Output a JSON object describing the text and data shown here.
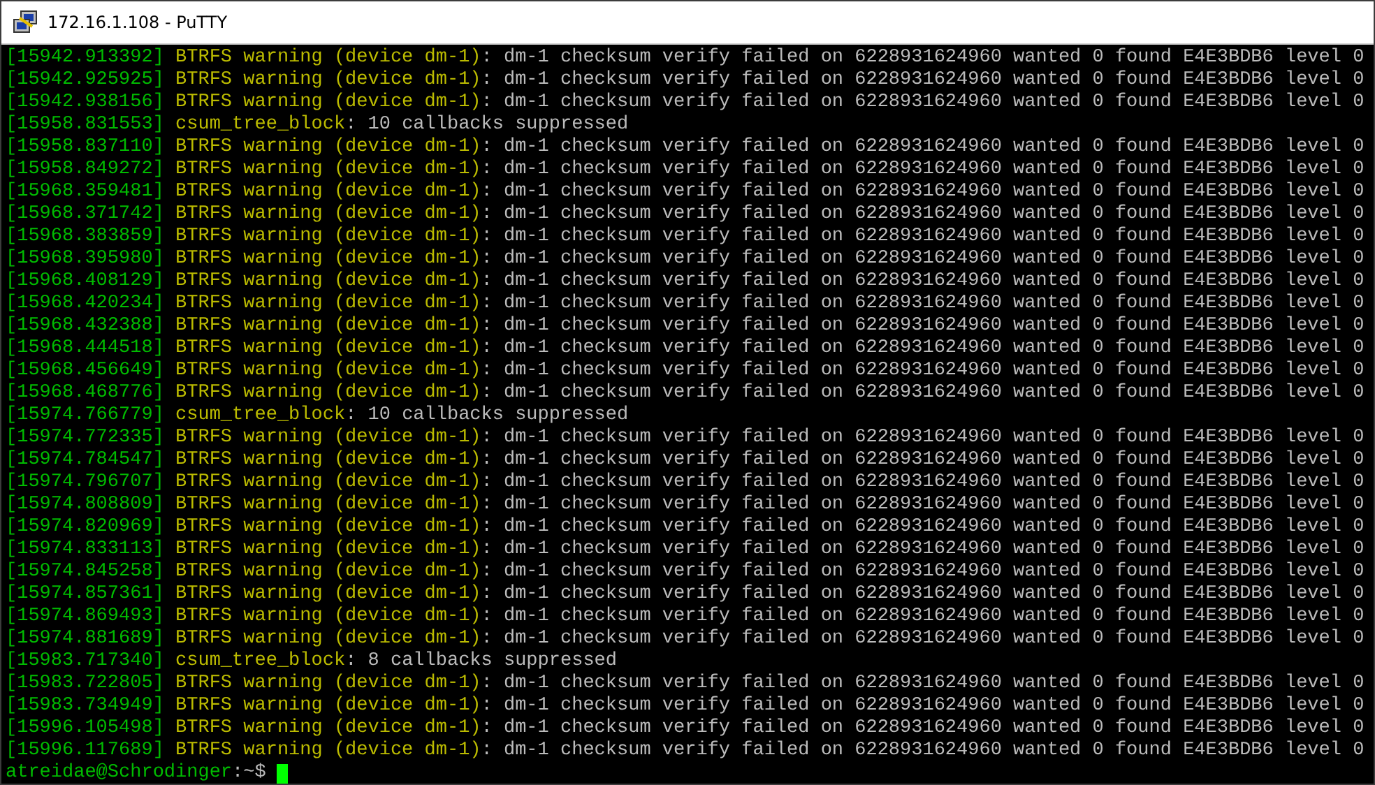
{
  "window": {
    "title": "172.16.1.108 - PuTTY"
  },
  "terminal": {
    "lines": [
      {
        "timestamp": "[15942.913392]",
        "source": "BTRFS warning (device dm-1)",
        "message": ": dm-1 checksum verify failed on 6228931624960 wanted 0 found E4E3BDB6 level 0"
      },
      {
        "timestamp": "[15942.925925]",
        "source": "BTRFS warning (device dm-1)",
        "message": ": dm-1 checksum verify failed on 6228931624960 wanted 0 found E4E3BDB6 level 0"
      },
      {
        "timestamp": "[15942.938156]",
        "source": "BTRFS warning (device dm-1)",
        "message": ": dm-1 checksum verify failed on 6228931624960 wanted 0 found E4E3BDB6 level 0"
      },
      {
        "timestamp": "[15958.831553]",
        "source": "csum_tree_block",
        "message": ": 10 callbacks suppressed"
      },
      {
        "timestamp": "[15958.837110]",
        "source": "BTRFS warning (device dm-1)",
        "message": ": dm-1 checksum verify failed on 6228931624960 wanted 0 found E4E3BDB6 level 0"
      },
      {
        "timestamp": "[15958.849272]",
        "source": "BTRFS warning (device dm-1)",
        "message": ": dm-1 checksum verify failed on 6228931624960 wanted 0 found E4E3BDB6 level 0"
      },
      {
        "timestamp": "[15968.359481]",
        "source": "BTRFS warning (device dm-1)",
        "message": ": dm-1 checksum verify failed on 6228931624960 wanted 0 found E4E3BDB6 level 0"
      },
      {
        "timestamp": "[15968.371742]",
        "source": "BTRFS warning (device dm-1)",
        "message": ": dm-1 checksum verify failed on 6228931624960 wanted 0 found E4E3BDB6 level 0"
      },
      {
        "timestamp": "[15968.383859]",
        "source": "BTRFS warning (device dm-1)",
        "message": ": dm-1 checksum verify failed on 6228931624960 wanted 0 found E4E3BDB6 level 0"
      },
      {
        "timestamp": "[15968.395980]",
        "source": "BTRFS warning (device dm-1)",
        "message": ": dm-1 checksum verify failed on 6228931624960 wanted 0 found E4E3BDB6 level 0"
      },
      {
        "timestamp": "[15968.408129]",
        "source": "BTRFS warning (device dm-1)",
        "message": ": dm-1 checksum verify failed on 6228931624960 wanted 0 found E4E3BDB6 level 0"
      },
      {
        "timestamp": "[15968.420234]",
        "source": "BTRFS warning (device dm-1)",
        "message": ": dm-1 checksum verify failed on 6228931624960 wanted 0 found E4E3BDB6 level 0"
      },
      {
        "timestamp": "[15968.432388]",
        "source": "BTRFS warning (device dm-1)",
        "message": ": dm-1 checksum verify failed on 6228931624960 wanted 0 found E4E3BDB6 level 0"
      },
      {
        "timestamp": "[15968.444518]",
        "source": "BTRFS warning (device dm-1)",
        "message": ": dm-1 checksum verify failed on 6228931624960 wanted 0 found E4E3BDB6 level 0"
      },
      {
        "timestamp": "[15968.456649]",
        "source": "BTRFS warning (device dm-1)",
        "message": ": dm-1 checksum verify failed on 6228931624960 wanted 0 found E4E3BDB6 level 0"
      },
      {
        "timestamp": "[15968.468776]",
        "source": "BTRFS warning (device dm-1)",
        "message": ": dm-1 checksum verify failed on 6228931624960 wanted 0 found E4E3BDB6 level 0"
      },
      {
        "timestamp": "[15974.766779]",
        "source": "csum_tree_block",
        "message": ": 10 callbacks suppressed"
      },
      {
        "timestamp": "[15974.772335]",
        "source": "BTRFS warning (device dm-1)",
        "message": ": dm-1 checksum verify failed on 6228931624960 wanted 0 found E4E3BDB6 level 0"
      },
      {
        "timestamp": "[15974.784547]",
        "source": "BTRFS warning (device dm-1)",
        "message": ": dm-1 checksum verify failed on 6228931624960 wanted 0 found E4E3BDB6 level 0"
      },
      {
        "timestamp": "[15974.796707]",
        "source": "BTRFS warning (device dm-1)",
        "message": ": dm-1 checksum verify failed on 6228931624960 wanted 0 found E4E3BDB6 level 0"
      },
      {
        "timestamp": "[15974.808809]",
        "source": "BTRFS warning (device dm-1)",
        "message": ": dm-1 checksum verify failed on 6228931624960 wanted 0 found E4E3BDB6 level 0"
      },
      {
        "timestamp": "[15974.820969]",
        "source": "BTRFS warning (device dm-1)",
        "message": ": dm-1 checksum verify failed on 6228931624960 wanted 0 found E4E3BDB6 level 0"
      },
      {
        "timestamp": "[15974.833113]",
        "source": "BTRFS warning (device dm-1)",
        "message": ": dm-1 checksum verify failed on 6228931624960 wanted 0 found E4E3BDB6 level 0"
      },
      {
        "timestamp": "[15974.845258]",
        "source": "BTRFS warning (device dm-1)",
        "message": ": dm-1 checksum verify failed on 6228931624960 wanted 0 found E4E3BDB6 level 0"
      },
      {
        "timestamp": "[15974.857361]",
        "source": "BTRFS warning (device dm-1)",
        "message": ": dm-1 checksum verify failed on 6228931624960 wanted 0 found E4E3BDB6 level 0"
      },
      {
        "timestamp": "[15974.869493]",
        "source": "BTRFS warning (device dm-1)",
        "message": ": dm-1 checksum verify failed on 6228931624960 wanted 0 found E4E3BDB6 level 0"
      },
      {
        "timestamp": "[15974.881689]",
        "source": "BTRFS warning (device dm-1)",
        "message": ": dm-1 checksum verify failed on 6228931624960 wanted 0 found E4E3BDB6 level 0"
      },
      {
        "timestamp": "[15983.717340]",
        "source": "csum_tree_block",
        "message": ": 8 callbacks suppressed"
      },
      {
        "timestamp": "[15983.722805]",
        "source": "BTRFS warning (device dm-1)",
        "message": ": dm-1 checksum verify failed on 6228931624960 wanted 0 found E4E3BDB6 level 0"
      },
      {
        "timestamp": "[15983.734949]",
        "source": "BTRFS warning (device dm-1)",
        "message": ": dm-1 checksum verify failed on 6228931624960 wanted 0 found E4E3BDB6 level 0"
      },
      {
        "timestamp": "[15996.105498]",
        "source": "BTRFS warning (device dm-1)",
        "message": ": dm-1 checksum verify failed on 6228931624960 wanted 0 found E4E3BDB6 level 0"
      },
      {
        "timestamp": "[15996.117689]",
        "source": "BTRFS warning (device dm-1)",
        "message": ": dm-1 checksum verify failed on 6228931624960 wanted 0 found E4E3BDB6 level 0"
      }
    ],
    "prompt": {
      "user_host": "atreidae@Schrodinger",
      "separator": ":",
      "path": "~$"
    }
  }
}
